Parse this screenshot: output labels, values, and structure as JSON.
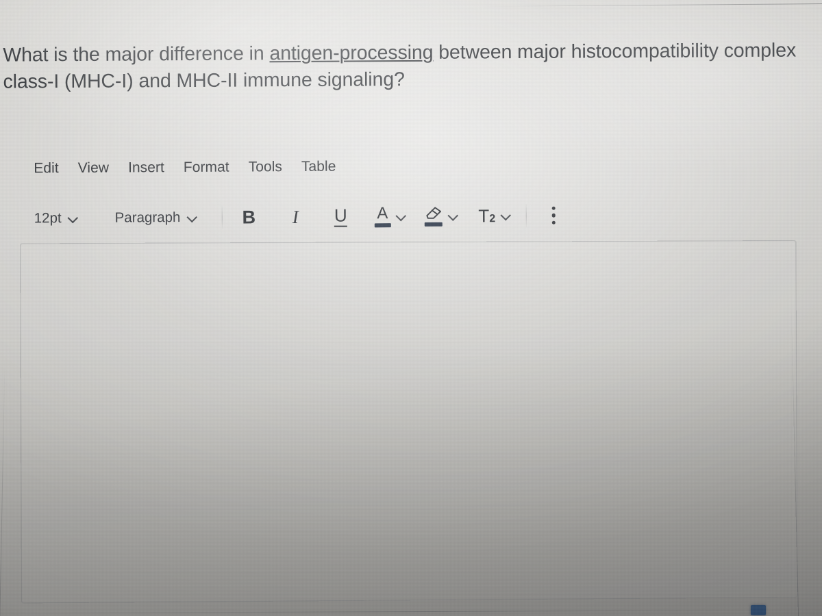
{
  "question": {
    "segments": [
      {
        "text": "What is the major difference in ",
        "underline": false
      },
      {
        "text": "antigen-processing",
        "underline": true
      },
      {
        "text": " between major histocompatibility complex class-I (MHC-I) and MHC-II immune signaling?",
        "underline": false
      }
    ],
    "full_text": "What is the major difference in antigen-processing between major histocompatibility complex class-I (MHC-I) and MHC-II immune signaling?"
  },
  "menubar": {
    "items": [
      {
        "label": "Edit"
      },
      {
        "label": "View"
      },
      {
        "label": "Insert"
      },
      {
        "label": "Format"
      },
      {
        "label": "Tools"
      },
      {
        "label": "Table"
      }
    ]
  },
  "toolbar": {
    "font_size": {
      "value": "12pt",
      "icon": "chevron-down-icon"
    },
    "block_format": {
      "value": "Paragraph",
      "icon": "chevron-down-icon"
    },
    "bold": {
      "label": "B",
      "icon": "bold-icon"
    },
    "italic": {
      "label": "I",
      "icon": "italic-icon"
    },
    "underline": {
      "label": "U",
      "icon": "underline-icon"
    },
    "text_color": {
      "label": "A",
      "icon": "text-color-icon",
      "swatch": "#1f2b3d"
    },
    "highlight_color": {
      "icon": "highlighter-icon",
      "swatch": "#1f2b3d"
    },
    "superscript": {
      "label": "T",
      "exponent": "2",
      "icon": "superscript-icon"
    },
    "more": {
      "icon": "kebab-menu-icon"
    }
  },
  "editor": {
    "content": "",
    "placeholder": ""
  },
  "colors": {
    "screen_background": "#c9c8c4",
    "text": "#2c2f33",
    "icon": "#23272c",
    "border": "#787b80",
    "accent_chip": "#2c4e78"
  }
}
